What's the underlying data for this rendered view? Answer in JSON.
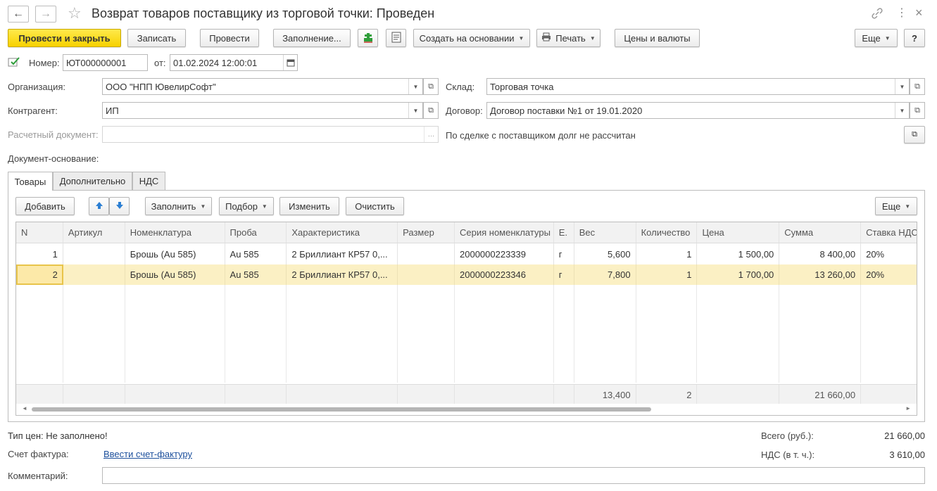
{
  "window": {
    "title": "Возврат товаров поставщику из торговой точки: Проведен",
    "back_icon": "←",
    "forward_icon": "→",
    "star_icon": "☆",
    "link_icon": "🔗",
    "more_icon": "⋮",
    "close_icon": "×"
  },
  "toolbar": {
    "post_close": "Провести и закрыть",
    "write": "Записать",
    "post": "Провести",
    "fill": "Заполнение...",
    "create_based": "Создать на основании",
    "print": "Печать",
    "prices_currency": "Цены и валюты",
    "more": "Еще",
    "help": "?"
  },
  "header": {
    "number_label": "Номер:",
    "number_value": "ЮТ000000001",
    "date_label": "от:",
    "date_value": "01.02.2024 12:00:01",
    "org_label": "Организация:",
    "org_value": "ООО \"НПП ЮвелирСофт\"",
    "contractor_label": "Контрагент:",
    "contractor_value": "ИП",
    "settlement_label": "Расчетный документ:",
    "settlement_value": "",
    "warehouse_label": "Склад:",
    "warehouse_value": "Торговая точка",
    "contract_label": "Договор:",
    "contract_value": "Договор поставки №1 от 19.01.2020",
    "debt_note": "По сделке с поставщиком долг не рассчитан",
    "basis_label": "Документ-основание:"
  },
  "tabs": [
    "Товары",
    "Дополнительно",
    "НДС"
  ],
  "table_toolbar": {
    "add": "Добавить",
    "fill": "Заполнить",
    "pick": "Подбор",
    "change": "Изменить",
    "clear": "Очистить",
    "more": "Еще"
  },
  "table": {
    "columns": [
      "N",
      "Артикул",
      "Номенклатура",
      "Проба",
      "Характеристика",
      "Размер",
      "Серия номенклатуры",
      "Е.",
      "Вес",
      "Количество",
      "Цена",
      "Сумма",
      "Ставка НДС"
    ],
    "rows": [
      [
        "1",
        "",
        "Брошь (Au 585)",
        "Au 585",
        "2 Бриллиант КР57 0,...",
        "",
        "2000000223339",
        "г",
        "5,600",
        "1",
        "1 500,00",
        "8 400,00",
        "20%"
      ],
      [
        "2",
        "",
        "Брошь (Au 585)",
        "Au 585",
        "2 Бриллиант КР57 0,...",
        "",
        "2000000223346",
        "г",
        "7,800",
        "1",
        "1 700,00",
        "13 260,00",
        "20%"
      ]
    ],
    "totals": [
      "",
      "",
      "",
      "",
      "",
      "",
      "",
      "",
      "13,400",
      "2",
      "",
      "21 660,00",
      ""
    ]
  },
  "footer": {
    "price_type": "Тип цен: Не заполнено!",
    "invoice_label": "Счет фактура:",
    "invoice_link": "Ввести счет-фактуру",
    "comment_label": "Комментарий:",
    "total_label": "Всего (руб.):",
    "total_value": "21 660,00",
    "vat_label": "НДС (в т. ч.):",
    "vat_value": "3 610,00"
  }
}
